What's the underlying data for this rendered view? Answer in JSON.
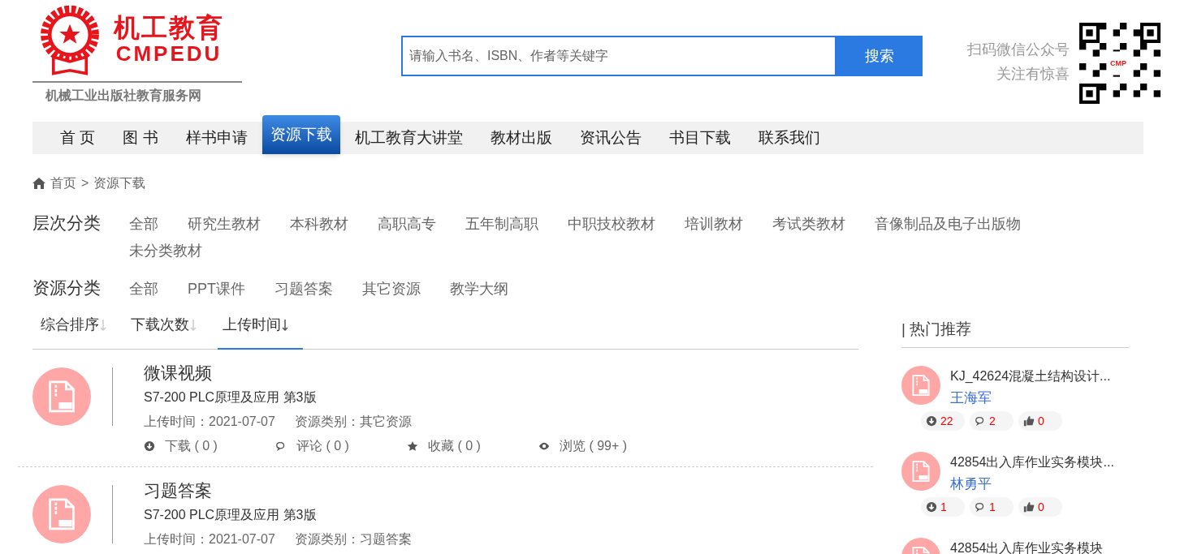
{
  "logo": {
    "title": "机工教育",
    "subtitle": "CMPEDU",
    "tagline": "机械工业出版社教育服务网"
  },
  "search": {
    "placeholder": "请输入书名、ISBN、作者等关键字",
    "button": "搜索"
  },
  "wechat": {
    "line_1": "扫码微信公众号",
    "line_2": "关注有惊喜",
    "qr_label": "CMP"
  },
  "nav": [
    {
      "label": "首 页",
      "selected": false
    },
    {
      "label": "图 书",
      "selected": false
    },
    {
      "label": "样书申请",
      "selected": false
    },
    {
      "label": "资源下载",
      "selected": true
    },
    {
      "label": "机工教育大讲堂",
      "selected": false
    },
    {
      "label": "教材出版",
      "selected": false
    },
    {
      "label": "资讯公告",
      "selected": false
    },
    {
      "label": "书目下载",
      "selected": false
    },
    {
      "label": "联系我们",
      "selected": false
    }
  ],
  "breadcrumb": {
    "home": "首页",
    "separator": ">",
    "current": "资源下载"
  },
  "filters": [
    {
      "label": "层次分类",
      "options": [
        "全部",
        "研究生教材",
        "本科教材",
        "高职高专",
        "五年制高职",
        "中职技校教材",
        "培训教材",
        "考试类教材",
        "音像制品及电子出版物",
        "未分类教材"
      ]
    },
    {
      "label": "资源分类",
      "options": [
        "全部",
        "PPT课件",
        "习题答案",
        "其它资源",
        "教学大纲"
      ]
    }
  ],
  "sort_tabs": [
    {
      "label": "综合排序",
      "selected": false
    },
    {
      "label": "下载次数",
      "selected": false
    },
    {
      "label": "上传时间",
      "selected": true
    }
  ],
  "resources": [
    {
      "title": "微课视频",
      "book": "S7-200 PLC原理及应用 第3版",
      "upload": "上传时间：2021-07-07",
      "category": "资源类别：其它资源",
      "stats": [
        "下载 ( 0 )",
        "评论 ( 0 )",
        "收藏 ( 0 )",
        "浏览 ( 99+ )"
      ]
    },
    {
      "title": "习题答案",
      "book": "S7-200 PLC原理及应用 第3版",
      "upload": "上传时间：2021-07-07",
      "category": "资源类别：习题答案"
    }
  ],
  "hot": {
    "title": "| 热门推荐",
    "items": [
      {
        "title": "KJ_42624混凝土结构设计...",
        "author": "王海军",
        "downloads": "22",
        "comments": "2",
        "likes": "0"
      },
      {
        "title": "42854出入库作业实务模块...",
        "author": "林勇平",
        "downloads": "1",
        "comments": "1",
        "likes": "0"
      },
      {
        "title": "42854出入库作业实务模块"
      }
    ]
  }
}
